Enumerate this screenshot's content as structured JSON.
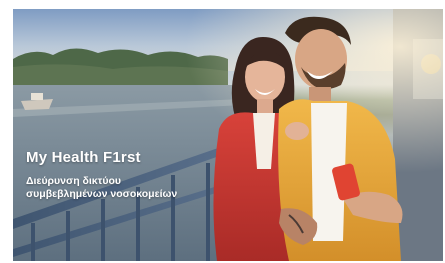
{
  "banner": {
    "headline": "My Health F1rst",
    "subline_1": "Διεύρυνση δικτύου",
    "subline_2": "συμβεβλημένων νοσοκομείων"
  }
}
